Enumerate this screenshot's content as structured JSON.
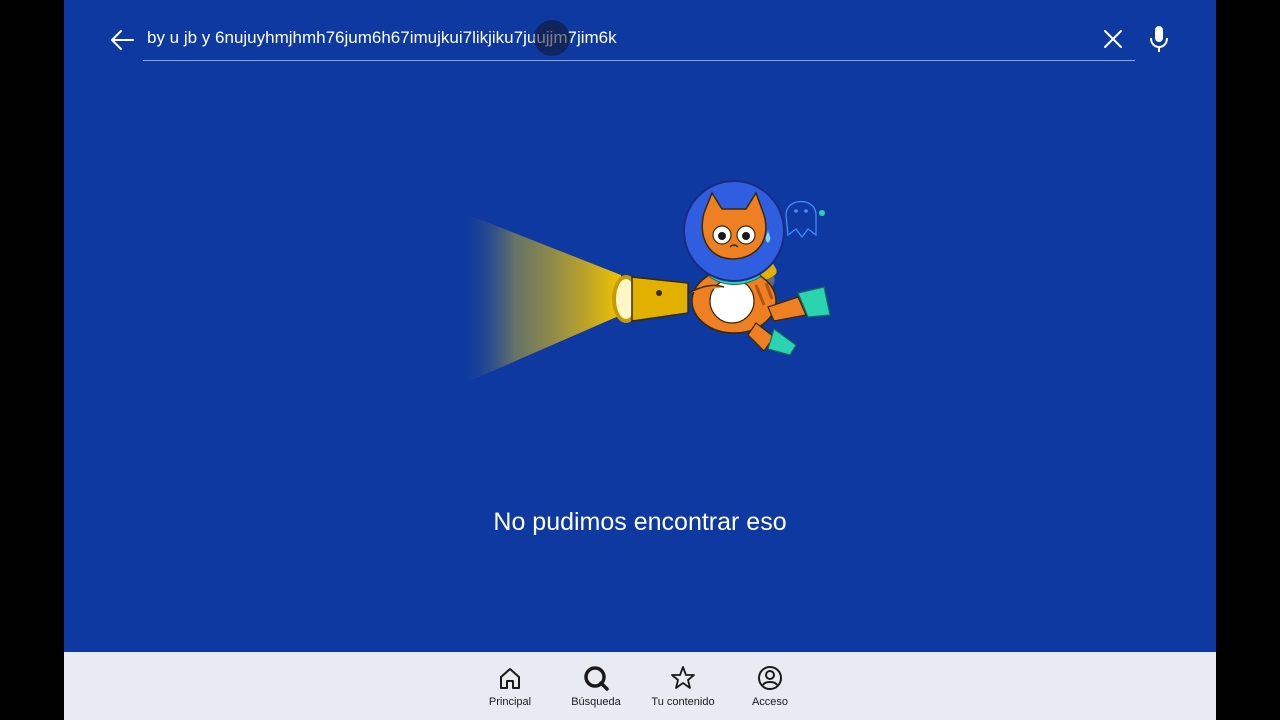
{
  "search": {
    "query": "by u jb y 6nujuyhmjhmh76jum6h67imujkui7likjiku7juujjm7jim6k",
    "back_icon": "arrow-left-icon",
    "clear_icon": "close-icon",
    "mic_icon": "microphone-icon"
  },
  "empty_state": {
    "message": "No pudimos encontrar eso",
    "illustration": "astronaut-cat-with-flashlight"
  },
  "bottom_nav": {
    "items": [
      {
        "label": "Principal",
        "icon": "home-icon"
      },
      {
        "label": "Búsqueda",
        "icon": "search-icon",
        "active": true
      },
      {
        "label": "Tu contenido",
        "icon": "star-icon"
      },
      {
        "label": "Acceso",
        "icon": "account-icon"
      }
    ]
  },
  "colors": {
    "background": "#0d39a0",
    "nav_background": "#e8ebf2",
    "text": "#ffffff",
    "flashlight": "#f2c200",
    "cat": "#ef7f23",
    "fins": "#2bd4b0",
    "helmet": "#2f5fe0"
  }
}
